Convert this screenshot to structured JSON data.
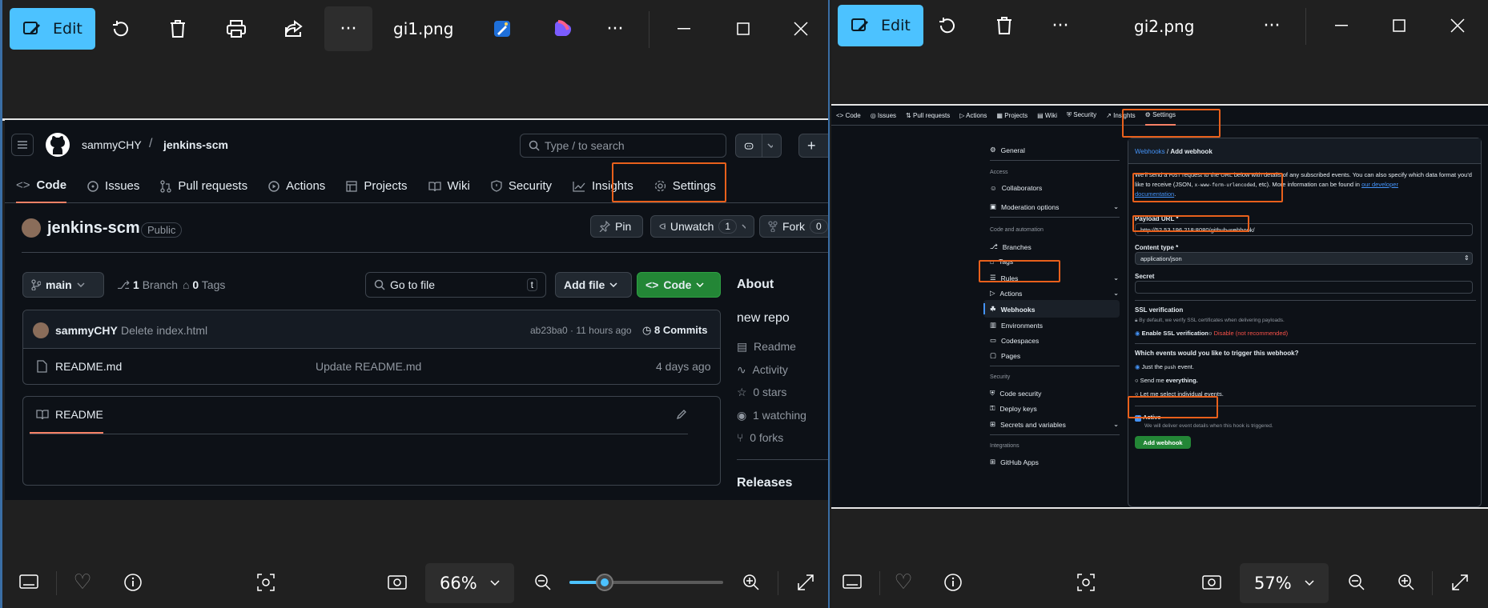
{
  "left": {
    "toolbar": {
      "edit": "Edit",
      "file": "gi1.png",
      "more": "···",
      "more2": "···"
    },
    "github": {
      "user": "sammyCHY",
      "slash": "/",
      "repo": "jenkins-scm",
      "search": "Type / to search",
      "search_key": "/",
      "nav": [
        "Code",
        "Issues",
        "Pull requests",
        "Actions",
        "Projects",
        "Wiki",
        "Security",
        "Insights",
        "Settings"
      ],
      "repo_title": "jenkins-scm",
      "visibility": "Public",
      "pin": "Pin",
      "unwatch": "Unwatch",
      "watch_count": "1",
      "fork": "Fork",
      "fork_count": "0",
      "branch": "main",
      "branches_n": "1",
      "branches": "Branch",
      "tags_n": "0",
      "tags": "Tags",
      "goto": "Go to file",
      "goto_key": "t",
      "addfile": "Add file",
      "code": "Code",
      "commit": {
        "author": "sammyCHY",
        "msg": "Delete index.html",
        "hash": "ab23ba0 · 11 hours ago",
        "commits_n": "8",
        "commits": "Commits"
      },
      "files": [
        {
          "name": "README.md",
          "msg": "Update README.md",
          "time": "4 days ago"
        }
      ],
      "readme": "README",
      "about": {
        "title": "About",
        "desc": "new repo",
        "readme": "Readme",
        "activity": "Activity",
        "stars": "0 stars",
        "watching": "1 watching",
        "forks": "0 forks"
      },
      "releases": "Releases"
    },
    "zoom": "66%",
    "zoom_fraction": 0.23
  },
  "right": {
    "toolbar": {
      "edit": "Edit",
      "file": "gi2.png",
      "more": "···",
      "more2": "···"
    },
    "github": {
      "nav": [
        "Code",
        "Issues",
        "Pull requests",
        "Actions",
        "Projects",
        "Wiki",
        "Security",
        "Insights",
        "Settings"
      ],
      "sidebar": {
        "general": "General",
        "access": "Access",
        "collaborators": "Collaborators",
        "moderation": "Moderation options",
        "code_automation": "Code and automation",
        "branches": "Branches",
        "tags": "Tags",
        "rules": "Rules",
        "actions": "Actions",
        "webhooks": "Webhooks",
        "environments": "Environments",
        "codespaces": "Codespaces",
        "pages": "Pages",
        "security": "Security",
        "code_security": "Code security",
        "deploy_keys": "Deploy keys",
        "secrets": "Secrets and variables",
        "integrations": "Integrations",
        "github_apps": "GitHub Apps"
      },
      "crumb_link": "Webhooks",
      "crumb_sep": " / ",
      "crumb_page": "Add webhook",
      "intro1": "We'll send a",
      "intro_post": "POST",
      "intro2": "request to the URL below with details of any subscribed events. You can also specify which data",
      "intro3": "format you'd like to receive (JSON,",
      "intro_form": "x-www-form-urlencoded",
      "intro4": ", etc). More information can be found in",
      "intro_link1": "our developer",
      "intro_link2": "documentation",
      "payload_label": "Payload URL *",
      "payload_value": "http://52.53.196.218:8080/github-webhook/",
      "content_label": "Content type *",
      "content_value": "application/json",
      "secret_label": "Secret",
      "ssl_label": "SSL verification",
      "ssl_note": "By default, we verify SSL certificates when delivering payloads.",
      "ssl_enable": "Enable SSL verification",
      "ssl_disable": "Disable",
      "ssl_disable_note": "(not recommended)",
      "events_label": "Which events would you like to trigger this webhook?",
      "ev1a": "Just the",
      "ev1b": "push",
      "ev1c": "event.",
      "ev2a": "Send me",
      "ev2b": "everything.",
      "ev3": "Let me select individual events.",
      "active": "Active",
      "active_note": "We will deliver event details when this hook is triggered.",
      "add_btn": "Add webhook"
    },
    "zoom": "57%"
  },
  "colors": {
    "accent": "#4cc2ff",
    "highlight": "#e8601c",
    "gh_green": "#238636",
    "gh_link": "#4493f8"
  }
}
